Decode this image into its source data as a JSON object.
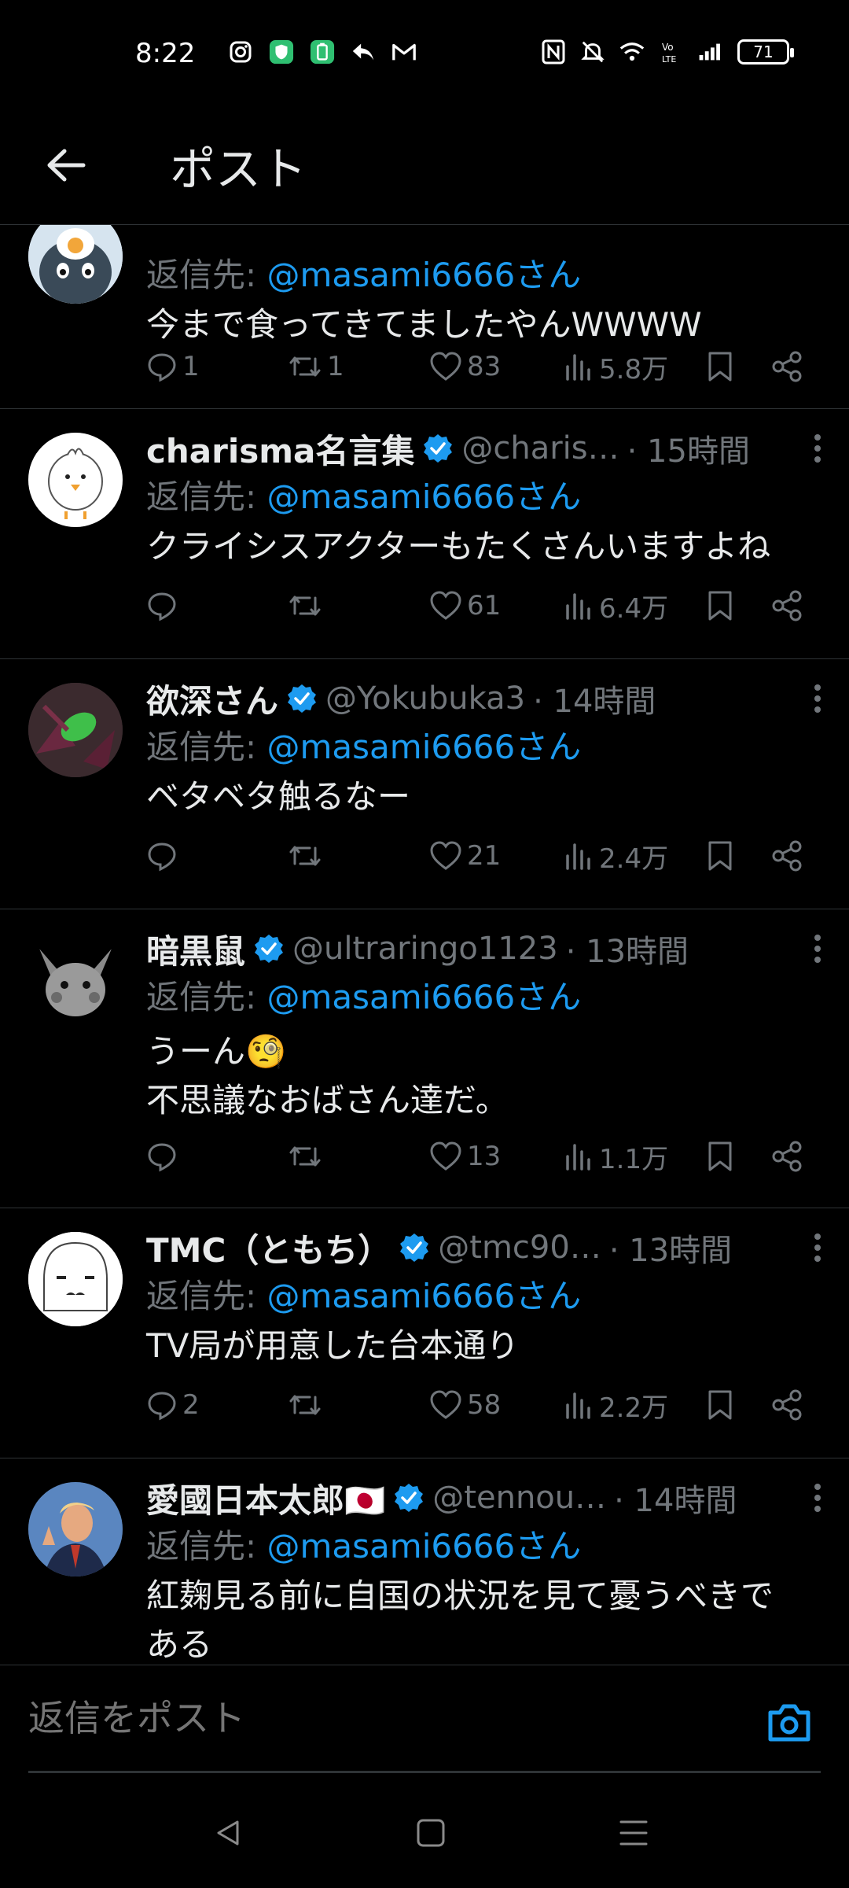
{
  "status": {
    "time": "8:22",
    "battery": "71"
  },
  "header": {
    "title": "ポスト"
  },
  "replies": [
    {
      "name": "",
      "handle": "",
      "time": "",
      "reply_to_prefix": "返信先: ",
      "reply_to_mention": "@masami6666さん",
      "text": "今まで食ってきてましたやんWWWW",
      "replies": "1",
      "retweets": "1",
      "likes": "83",
      "views": "5.8万"
    },
    {
      "name": "charisma名言集",
      "handle": "@charis…",
      "time": "· 15時間",
      "reply_to_prefix": "返信先: ",
      "reply_to_mention": "@masami6666さん",
      "text": "クライシスアクターもたくさんいますよね",
      "replies": "",
      "retweets": "",
      "likes": "61",
      "views": "6.4万"
    },
    {
      "name": "欲深さん",
      "handle": "@Yokubuka3",
      "time": "· 14時間",
      "reply_to_prefix": "返信先: ",
      "reply_to_mention": "@masami6666さん",
      "text": "ベタベタ触るなー",
      "replies": "",
      "retweets": "",
      "likes": "21",
      "views": "2.4万"
    },
    {
      "name": "暗黒鼠",
      "handle": "@ultraringo1123",
      "time": "· 13時間",
      "reply_to_prefix": "返信先: ",
      "reply_to_mention": "@masami6666さん",
      "text": "うーん🧐\n不思議なおばさん達だ。",
      "replies": "",
      "retweets": "",
      "likes": "13",
      "views": "1.1万"
    },
    {
      "name": "TMC（ともち）",
      "handle": "@tmc90…",
      "time": "· 13時間",
      "reply_to_prefix": "返信先: ",
      "reply_to_mention": "@masami6666さん",
      "text": "TV局が用意した台本通り",
      "replies": "2",
      "retweets": "",
      "likes": "58",
      "views": "2.2万"
    },
    {
      "name": "愛國日本太郎🇯🇵",
      "handle": "@tennou…",
      "time": "· 14時間",
      "reply_to_prefix": "返信先: ",
      "reply_to_mention": "@masami6666さん",
      "text": "紅麹見る前に自国の状況を見て憂うべきで\nある",
      "replies": "",
      "retweets": "",
      "likes": "",
      "views": ""
    }
  ],
  "composer": {
    "placeholder": "返信をポスト"
  },
  "colors": {
    "accent": "#1d9bf0",
    "muted": "#71767b",
    "background": "#000000",
    "text": "#e7e9ea"
  }
}
